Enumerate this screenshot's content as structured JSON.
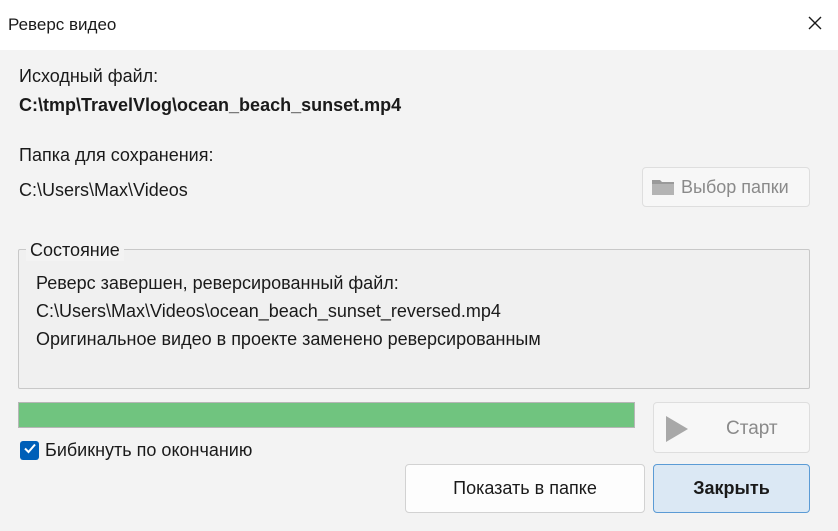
{
  "window": {
    "title": "Реверс видео",
    "close_icon": "close-icon"
  },
  "source": {
    "label": "Исходный файл:",
    "path": "C:\\tmp\\TravelVlog\\ocean_beach_sunset.mp4"
  },
  "output": {
    "label": "Папка для сохранения:",
    "path": "C:\\Users\\Max\\Videos",
    "choose_button": "Выбор папки",
    "choose_icon": "folder-icon"
  },
  "status": {
    "legend": "Состояние",
    "lines": [
      "Реверс завершен, реверсированный файл:",
      "C:\\Users\\Max\\Videos\\ocean_beach_sunset_reversed.mp4",
      "Оригинальное видео в проекте заменено реверсированным"
    ]
  },
  "progress": {
    "value": 1.0,
    "color": "#70c47f"
  },
  "start_button": {
    "label": "Старт",
    "icon": "play-icon",
    "enabled": false
  },
  "beep": {
    "label": "Бибикнуть по окончанию",
    "checked": true
  },
  "buttons": {
    "show_in_folder": "Показать в папке",
    "close": "Закрыть"
  },
  "colors": {
    "accent": "#005fb8",
    "default_button_border": "#5b9bd5"
  }
}
